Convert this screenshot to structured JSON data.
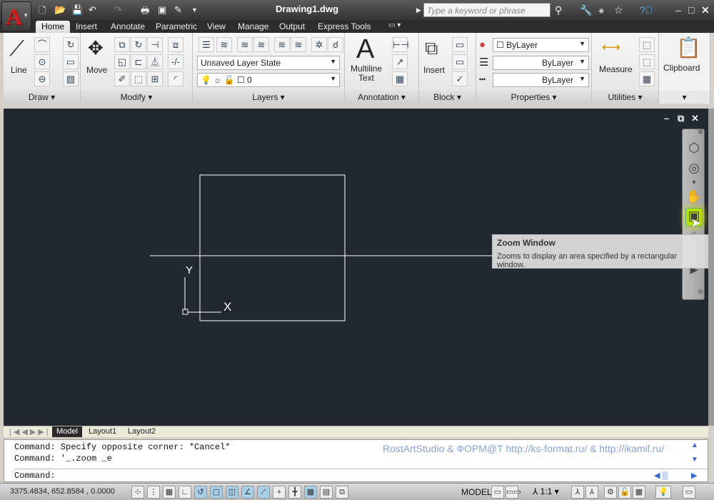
{
  "app": {
    "title": "Drawing1.dwg",
    "search_placeholder": "Type a keyword or phrase",
    "accent": "#d21e1e"
  },
  "tabs": [
    "Home",
    "Insert",
    "Annotate",
    "Parametric",
    "View",
    "Manage",
    "Output",
    "Express Tools"
  ],
  "panels": {
    "draw": {
      "title": "Draw",
      "line": "Line"
    },
    "modify": {
      "title": "Modify",
      "move": "Move"
    },
    "layers": {
      "title": "Layers",
      "layer_state": "Unsaved Layer State",
      "current_layer": "0"
    },
    "annotation": {
      "title": "Annotation",
      "mtext1": "Multiline",
      "mtext2": "Text"
    },
    "block": {
      "title": "Block",
      "insert": "Insert"
    },
    "properties": {
      "title": "Properties",
      "color": "ByLayer",
      "lineweight": "ByLayer",
      "linetype": "ByLayer"
    },
    "utilities": {
      "title": "Utilities",
      "measure": "Measure"
    },
    "clipboard": {
      "title": "Clipboard"
    }
  },
  "canvas": {
    "bg": "#222830",
    "ucs_x": "X",
    "ucs_y": "Y"
  },
  "tooltip": {
    "title": "Zoom Window",
    "desc": "Zooms to display an area specified by a rectangular window."
  },
  "layout_tabs": [
    "Model",
    "Layout1",
    "Layout2"
  ],
  "command": {
    "history": [
      "Command: Specify opposite corner: *Cancel*",
      "Command: '_.zoom _e"
    ],
    "prompt": "Command:",
    "watermark": "RostArtStudio & ФОРМ@Т http://ks-format.ru/ & http://ikamil.ru/"
  },
  "status": {
    "coords": "3375.4834, 652.8584 , 0.0000",
    "model": "MODEL",
    "scale": "1:1"
  }
}
